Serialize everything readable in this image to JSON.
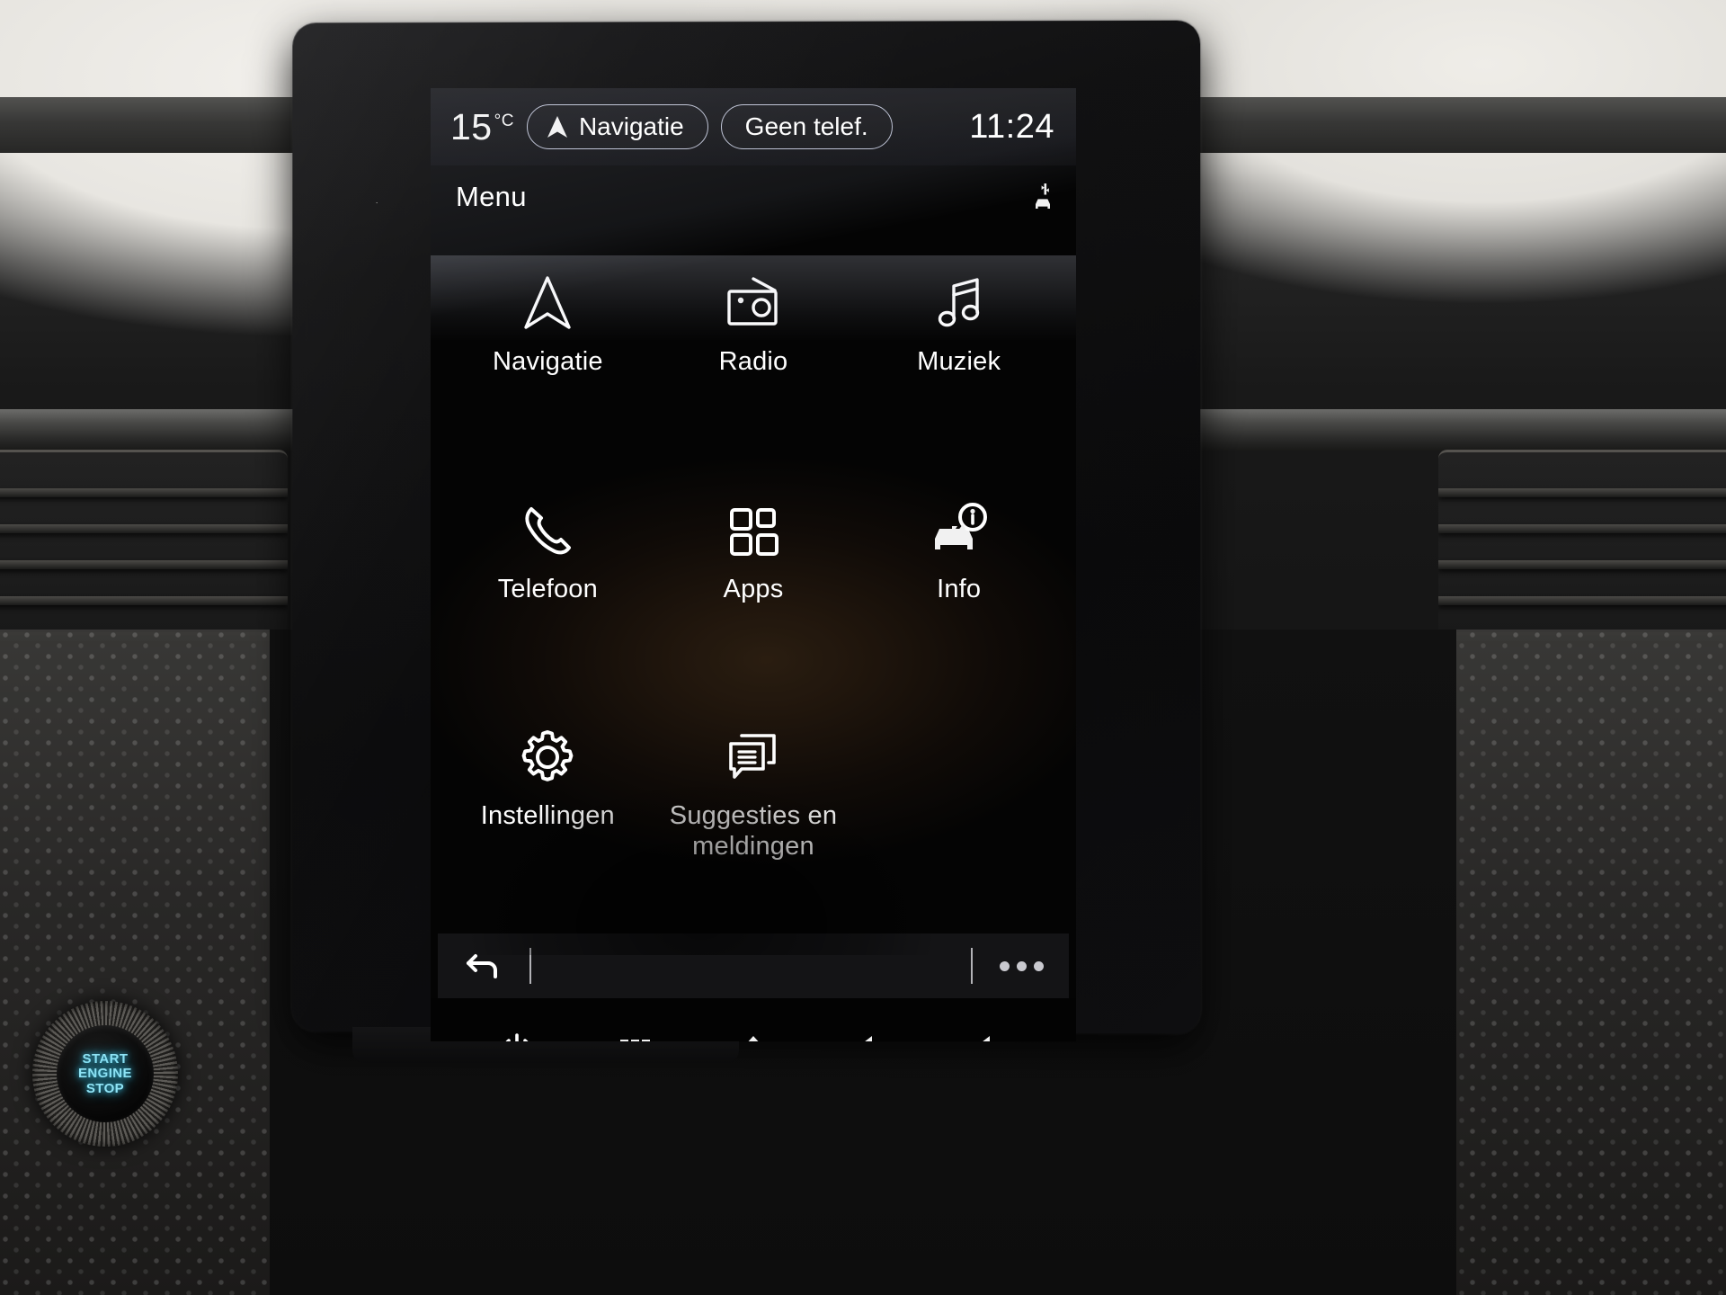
{
  "status_bar": {
    "temperature": "15",
    "temperature_unit": "°C",
    "nav_pill_label": "Navigatie",
    "phone_pill_label": "Geen telef.",
    "clock": "11:24"
  },
  "page_header": {
    "title": "Menu",
    "connectivity_icon": "car-antenna-icon"
  },
  "menu": {
    "tiles": [
      {
        "label": "Navigatie",
        "icon": "navigation-arrow-icon"
      },
      {
        "label": "Radio",
        "icon": "radio-icon"
      },
      {
        "label": "Muziek",
        "icon": "music-note-icon"
      },
      {
        "label": "Telefoon",
        "icon": "phone-handset-icon"
      },
      {
        "label": "Apps",
        "icon": "apps-grid-icon"
      },
      {
        "label": "Info",
        "icon": "car-info-icon"
      },
      {
        "label": "Instellingen",
        "icon": "gear-icon"
      },
      {
        "label": "Suggesties en meldingen",
        "icon": "messages-icon"
      }
    ]
  },
  "context_bar": {
    "back_icon": "back-arrow-icon",
    "more_icon": "more-dots-icon"
  },
  "hard_bar": {
    "buttons": [
      {
        "name": "power",
        "icon": "power-icon"
      },
      {
        "name": "apps-menu",
        "icon": "grid-menu-icon"
      },
      {
        "name": "home",
        "icon": "home-icon"
      },
      {
        "name": "volume-down",
        "icon": "volume-down-icon"
      },
      {
        "name": "volume-up",
        "icon": "volume-up-icon"
      }
    ]
  },
  "dashboard": {
    "start_button": {
      "line1": "START",
      "line2": "ENGINE",
      "line3": "STOP"
    }
  },
  "colors": {
    "screen_bg": "#040404",
    "text": "#ffffff",
    "pill_border": "#b9bed1",
    "start_button_glow": "#8fe3f5"
  }
}
